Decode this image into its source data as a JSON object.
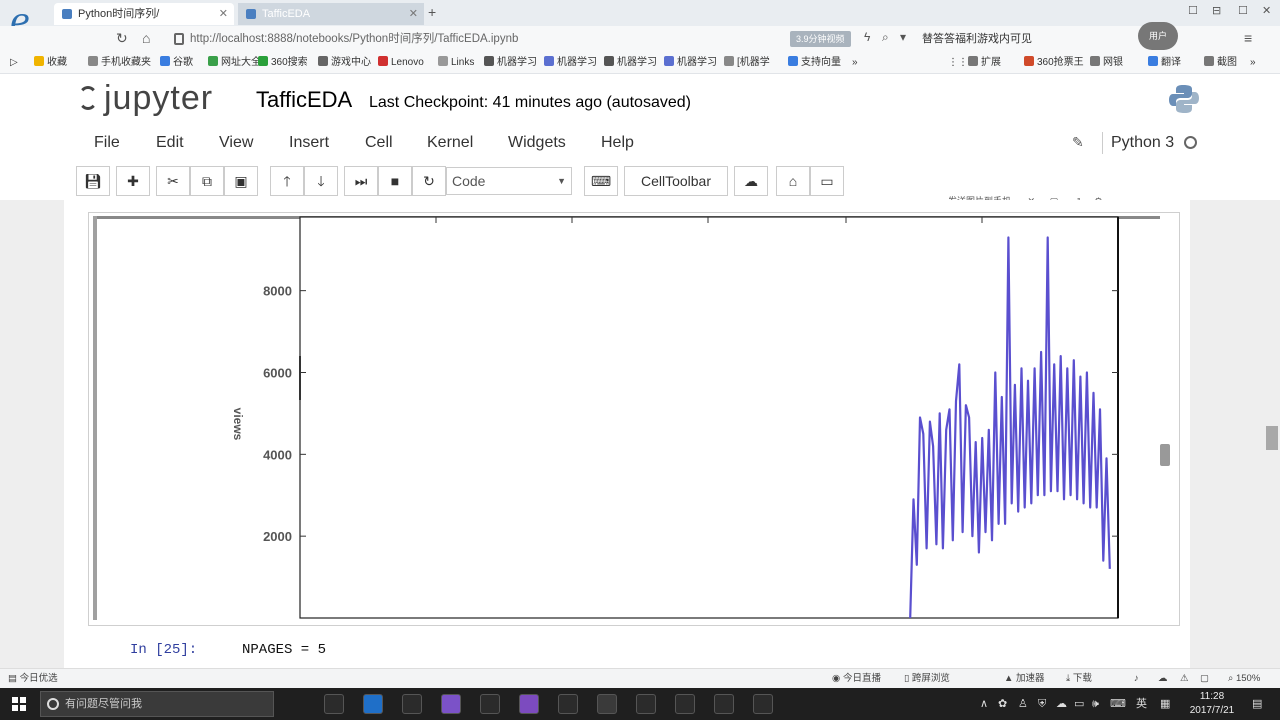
{
  "browser": {
    "tabs": [
      {
        "label": "Python时间序列/",
        "active": true
      },
      {
        "label": "TafficEDA",
        "active": false
      }
    ],
    "address": "http://localhost:8888/notebooks/Python时间序列/TafficEDA.ipynb",
    "address_button": "3.9分钟视频",
    "address_right": "替答答福利游戏内可见",
    "avatar_label": "用户",
    "bookmarks": [
      "收藏",
      "手机收藏夹",
      "谷歌",
      "网址大全",
      "360搜索",
      "游戏中心",
      "Lenovo",
      "Links",
      "机器学习",
      "机器学习",
      "机器学习",
      "机器学习",
      "[机器学",
      "支持向量"
    ],
    "bookmarks_right": [
      "扩展",
      "360抢票王",
      "网银",
      "翻译",
      "截图"
    ],
    "float_bar_label": "发送图片到手机",
    "status_left": "今日优选",
    "status_right": [
      "今日直播",
      "跨屏浏览",
      "加速器",
      "下载"
    ],
    "zoom": "150%"
  },
  "notebook": {
    "logo_text": "jupyter",
    "name": "TafficEDA",
    "checkpoint": "Last Checkpoint: 41 minutes ago (autosaved)",
    "menu": [
      "File",
      "Edit",
      "View",
      "Insert",
      "Cell",
      "Kernel",
      "Widgets",
      "Help"
    ],
    "kernel": "Python 3",
    "cell_type": "Code",
    "celltoolbar": "CellToolbar",
    "in_prompt": "In [25]:",
    "code_line": "NPAGES = 5"
  },
  "taskbar": {
    "search_placeholder": "有问题尽管问我",
    "time": "11:28",
    "date": "2017/7/21",
    "ime": "英",
    "apps": [
      {
        "name": "task-view",
        "color": "#2b2b2b"
      },
      {
        "name": "edge",
        "color": "#1f6fc8"
      },
      {
        "name": "store",
        "color": "#2b2b2b"
      },
      {
        "name": "app-b",
        "color": "#7b52c8"
      },
      {
        "name": "chrome",
        "color": "#2b2b2b"
      },
      {
        "name": "app-vs",
        "color": "#7c4bbf"
      },
      {
        "name": "app-check",
        "color": "#2b2b2b"
      },
      {
        "name": "app-circle",
        "color": "#3a3a3a"
      },
      {
        "name": "app-swirl",
        "color": "#2b2b2b"
      },
      {
        "name": "app-notes",
        "color": "#2b2b2b"
      },
      {
        "name": "app-pc",
        "color": "#2b2b2b"
      },
      {
        "name": "app-q",
        "color": "#2b2b2b"
      }
    ]
  },
  "chart_data": {
    "type": "line",
    "ylabel": "views",
    "yticks": [
      "8000",
      "6000",
      "4000",
      "2000"
    ],
    "ylim": [
      0,
      9800
    ],
    "x_index_range": [
      0,
      100
    ],
    "color": "#5a4fcf",
    "series": [
      {
        "x": [
          74.6,
          75.0,
          75.4,
          75.8,
          76.2,
          76.6,
          77.0,
          77.4,
          77.8,
          78.2,
          78.6,
          79.0,
          79.4,
          79.8,
          80.2,
          80.6,
          81.0,
          81.4,
          81.8,
          82.2,
          82.6,
          83.0,
          83.4,
          83.8,
          84.2,
          84.6,
          85.0,
          85.4,
          85.8,
          86.2,
          86.6,
          87.0,
          87.4,
          87.8,
          88.2,
          88.6,
          89.0,
          89.4,
          89.8,
          90.2,
          90.6,
          91.0,
          91.4,
          91.8,
          92.2,
          92.6,
          93.0,
          93.4,
          93.8,
          94.2,
          94.6,
          95.0,
          95.4,
          95.8,
          96.2,
          96.6,
          97.0,
          97.4,
          97.8,
          98.2,
          98.6,
          99.0
        ],
        "y": [
          0,
          2900,
          1300,
          4900,
          4500,
          1700,
          4800,
          4200,
          1800,
          5000,
          1700,
          4600,
          5100,
          1900,
          5300,
          6200,
          2100,
          5200,
          4900,
          2000,
          4300,
          1600,
          4400,
          2100,
          4600,
          1900,
          6000,
          2300,
          5400,
          2300,
          9300,
          2800,
          5700,
          2600,
          6100,
          2700,
          5800,
          2800,
          6100,
          3000,
          6500,
          3000,
          9300,
          3100,
          6200,
          3100,
          6400,
          2900,
          6100,
          3000,
          6300,
          2900,
          5900,
          2800,
          6000,
          2700,
          5500,
          2700,
          5100,
          1400,
          3900,
          1200
        ]
      }
    ]
  }
}
